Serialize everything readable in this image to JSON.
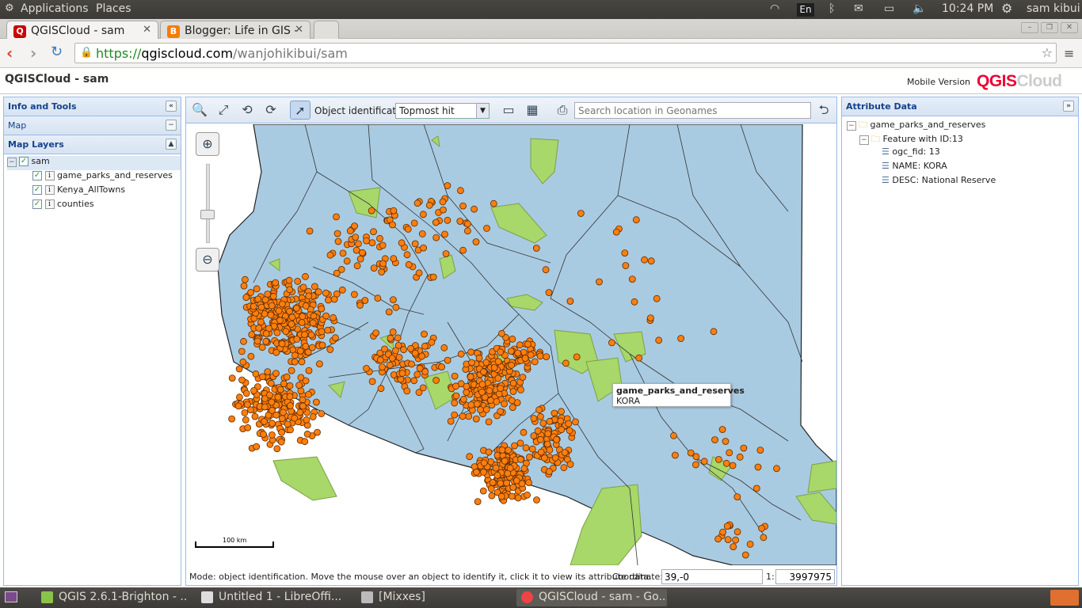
{
  "system_bar": {
    "apps_label": "Applications",
    "places_label": "Places",
    "keyboard": "En",
    "time": "10:24 PM",
    "user": "sam kibui"
  },
  "browser": {
    "tabs": [
      {
        "title": "QGISCloud - sam",
        "active": true
      },
      {
        "title": "Blogger: Life in GIS -",
        "active": false
      }
    ],
    "url_scheme": "https://",
    "url_host": "qgiscloud.com",
    "url_path": "/wanjohikibui/sam"
  },
  "app": {
    "title": "QGISCloud - sam",
    "mobile_link": "Mobile Version",
    "logo_a": "QGIS",
    "logo_b": "Cloud"
  },
  "left_panel": {
    "header": "Info and Tools",
    "map_section": "Map",
    "layers_section": "Map Layers",
    "root": "sam",
    "layers": [
      "game_parks_and_reserves",
      "Kenya_AllTowns",
      "counties"
    ]
  },
  "toolbar": {
    "ident_label": "Object identification:",
    "ident_value": "Topmost hit",
    "search_placeholder": "Search location in Geonames"
  },
  "map": {
    "tooltip_title": "game_parks_and_reserves",
    "tooltip_value": "KORA",
    "scale_label": "100 km",
    "colors": {
      "water": "#a9cbe2",
      "park": "#a8d76a",
      "town": "#ff7f0e"
    }
  },
  "statusbar": {
    "mode": "Mode: object identification. Move the mouse over an object to identify it, click it to view its attribute data.",
    "coord_label": "Coordinate:",
    "coord_value": "39,-0",
    "scale_prefix": "1:",
    "scale_value": "3997975"
  },
  "right_panel": {
    "header": "Attribute Data",
    "layer": "game_parks_and_reserves",
    "feature": "Feature with ID:13",
    "attrs": [
      "ogc_fid: 13",
      "NAME: KORA",
      "DESC: National Reserve"
    ]
  },
  "taskbar": {
    "items": [
      "QGIS 2.6.1-Brighton - ...",
      "Untitled 1 - LibreOffi...",
      "[Mixxes]",
      "QGISCloud - sam - Go..."
    ]
  }
}
